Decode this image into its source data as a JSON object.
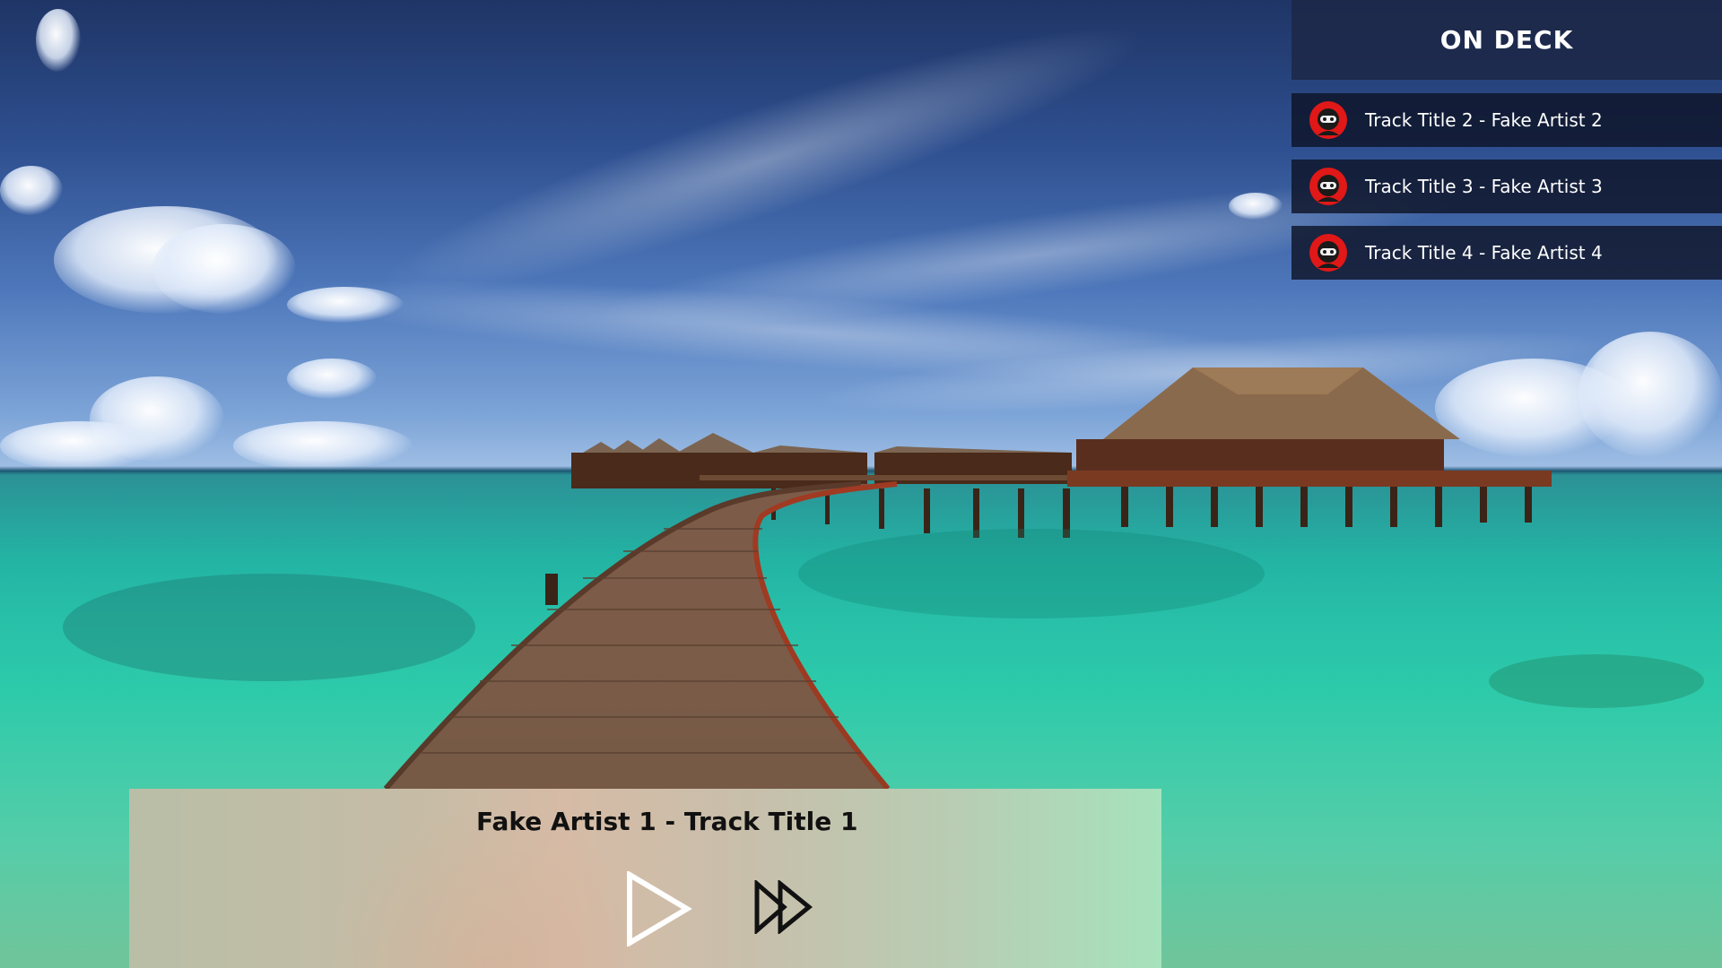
{
  "on_deck": {
    "title": "ON DECK",
    "items": [
      {
        "label": "Track Title 2 - Fake Artist 2",
        "icon": "ninja-avatar-icon"
      },
      {
        "label": "Track Title 3 - Fake Artist 3",
        "icon": "ninja-avatar-icon"
      },
      {
        "label": "Track Title 4 - Fake Artist 4",
        "icon": "ninja-avatar-icon"
      }
    ]
  },
  "player": {
    "now_playing": "Fake Artist 1 - Track Title 1",
    "controls": [
      {
        "name": "play",
        "icon": "play-icon"
      },
      {
        "name": "fast-forward",
        "icon": "fast-forward-icon"
      }
    ]
  },
  "colors": {
    "deck_header_bg": "#1c2848",
    "deck_item_bg": "#0c1224",
    "avatar_red": "#e01818",
    "text_light": "#ffffff",
    "text_dark": "#111111"
  }
}
